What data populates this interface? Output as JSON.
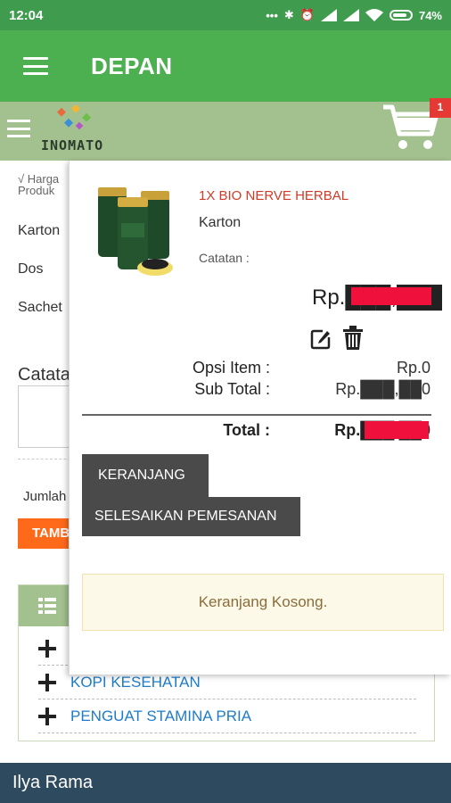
{
  "status_bar": {
    "time": "12:04",
    "icons": [
      "more-dots-icon",
      "bluetooth-icon",
      "alarm-icon",
      "signal-icon",
      "signal-icon",
      "wifi-icon",
      "battery-icon"
    ],
    "battery": "74%"
  },
  "app_bar": {
    "title": "DEPAN"
  },
  "header": {
    "logo_text": "INOMATO",
    "cart_badge": "1"
  },
  "product_page": {
    "note_line1": "√ Harga",
    "note_line2": "Produk",
    "options": [
      "Karton",
      "Dos",
      "Sachet"
    ],
    "catatan_label": "Catatan",
    "jumlah_label": "Jumlah",
    "add_button": "TAMBAH"
  },
  "categories": {
    "items": [
      "KOPI KESEHATAN",
      "PENGUAT STAMINA PRIA"
    ]
  },
  "cart": {
    "item": {
      "name": "1X BIO NERVE HERBAL",
      "unit": "Karton",
      "note_label": "Catatan :",
      "price": "Rp.███,███"
    },
    "option_label": "Opsi Item :",
    "option_value": "Rp.0",
    "subtotal_label": "Sub Total :",
    "subtotal_value": "Rp.███,██0",
    "total_label": "Total :",
    "total_value": "Rp.███,██0",
    "cart_button": "KERANJANG",
    "checkout_button": "SELESAIKAN PEMESANAN",
    "empty_message": "Keranjang Kosong."
  },
  "footer": {
    "user_name": "Ilya Rama"
  },
  "colors": {
    "status_bar": "#3f9c4e",
    "app_bar": "#4caf50",
    "sub_header": "#a3c08f",
    "product_name": "#d23a28",
    "dark_button": "#4a4a4a",
    "add_button": "#ff6a1a",
    "footer": "#2e4a5e",
    "link": "#1e7cc8"
  }
}
